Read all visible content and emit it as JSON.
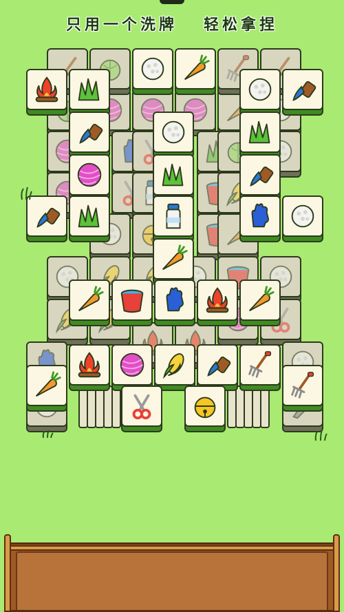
{
  "banner": {
    "left_text": "只用一个洗牌",
    "right_text": "轻松拿捏"
  },
  "colors": {
    "background": "#a9ea73",
    "tile_face": "#fbf7e2",
    "tile_base": "#3f8b22",
    "tray_wood": "#b7733a"
  },
  "board": {
    "tiles": [
      {
        "icon": "shovel-icon",
        "layer": "under"
      },
      {
        "icon": "cabbage-icon",
        "layer": "under"
      },
      {
        "icon": "rice-ball-icon",
        "layer": "top"
      },
      {
        "icon": "carrot-icon",
        "layer": "top"
      },
      {
        "icon": "rake-icon",
        "layer": "under"
      },
      {
        "icon": "shovel-icon",
        "layer": "under"
      },
      {
        "icon": "campfire-icon",
        "layer": "top"
      },
      {
        "icon": "grass-icon",
        "layer": "top"
      },
      {
        "icon": "rice-ball-icon",
        "layer": "top"
      },
      {
        "icon": "brush-icon",
        "layer": "top"
      },
      {
        "icon": "brush-icon",
        "layer": "top"
      },
      {
        "icon": "rice-ball-icon",
        "layer": "top"
      },
      {
        "icon": "grass-icon",
        "layer": "top"
      },
      {
        "icon": "yarn-ball-icon",
        "layer": "top"
      },
      {
        "icon": "grass-icon",
        "layer": "top"
      },
      {
        "icon": "brush-icon",
        "layer": "top"
      },
      {
        "icon": "brush-icon",
        "layer": "top"
      },
      {
        "icon": "grass-icon",
        "layer": "top"
      },
      {
        "icon": "milk-bottle-icon",
        "layer": "top"
      },
      {
        "icon": "glove-icon",
        "layer": "top"
      },
      {
        "icon": "rice-ball-icon",
        "layer": "top"
      },
      {
        "icon": "carrot-icon",
        "layer": "top"
      },
      {
        "icon": "carrot-icon",
        "layer": "top"
      },
      {
        "icon": "bucket-icon",
        "layer": "top"
      },
      {
        "icon": "glove-icon",
        "layer": "top"
      },
      {
        "icon": "campfire-icon",
        "layer": "top"
      },
      {
        "icon": "carrot-icon",
        "layer": "top"
      },
      {
        "icon": "campfire-icon",
        "layer": "top"
      },
      {
        "icon": "yarn-ball-icon",
        "layer": "top"
      },
      {
        "icon": "corn-icon",
        "layer": "top"
      },
      {
        "icon": "brush-icon",
        "layer": "top"
      },
      {
        "icon": "rake-icon",
        "layer": "top"
      },
      {
        "icon": "carrot-icon",
        "layer": "top"
      },
      {
        "icon": "rake-icon",
        "layer": "top"
      },
      {
        "icon": "scissors-icon",
        "layer": "top"
      },
      {
        "icon": "bell-icon",
        "layer": "top"
      }
    ]
  },
  "tray": {
    "slots_filled": 0
  }
}
